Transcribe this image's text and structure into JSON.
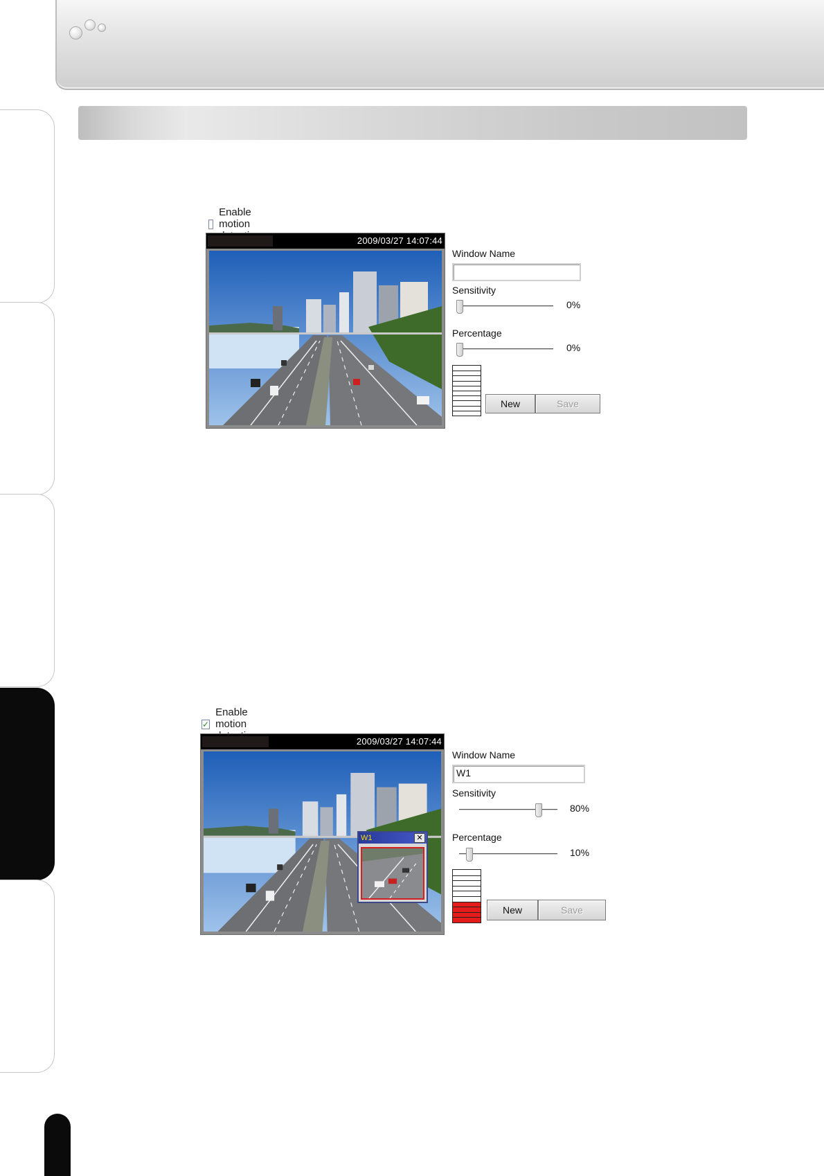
{
  "colors": {
    "meter_active": "#e41b1b",
    "motion_window_title": "#3f52c0",
    "motion_region_border": "#d42020"
  },
  "screens": [
    {
      "enable_label": "Enable motion detection",
      "enable_checked": false,
      "timestamp": "2009/03/27 14:07:44",
      "window_name_label": "Window Name",
      "window_name_value": "",
      "sensitivity_label": "Sensitivity",
      "sensitivity_value": "0%",
      "sensitivity_level": 0,
      "percentage_label": "Percentage",
      "percentage_value": "0%",
      "percentage_level": 0,
      "meter_segments": 10,
      "meter_active_segments": 0,
      "new_button": "New",
      "save_button": "Save",
      "save_enabled": false
    },
    {
      "enable_label": "Enable motion detection",
      "enable_checked": true,
      "timestamp": "2009/03/27 14:07:44",
      "window_name_label": "Window Name",
      "window_name_value": "W1",
      "sensitivity_label": "Sensitivity",
      "sensitivity_value": "80%",
      "sensitivity_level": 0.8,
      "percentage_label": "Percentage",
      "percentage_value": "10%",
      "percentage_level": 0.1,
      "meter_segments": 10,
      "meter_active_segments": 4,
      "new_button": "New",
      "save_button": "Save",
      "save_enabled": false,
      "motion_window_title": "W1",
      "motion_window_close": "✕"
    }
  ]
}
